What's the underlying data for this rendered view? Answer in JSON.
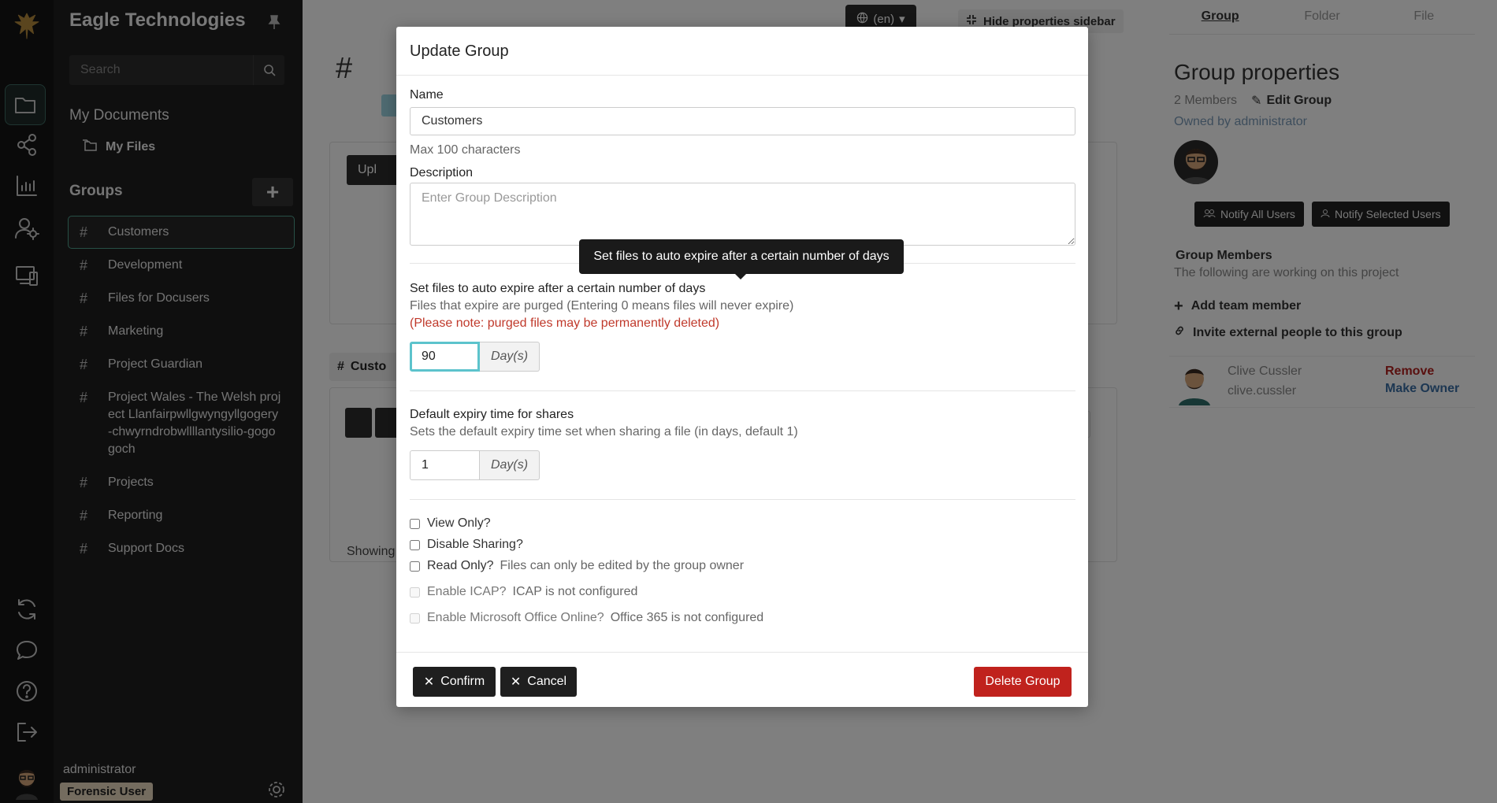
{
  "brand": {
    "name": "Eagle Technologies"
  },
  "sidebar": {
    "search_placeholder": "Search",
    "my_documents": "My Documents",
    "my_files": "My Files",
    "groups_title": "Groups",
    "groups": [
      {
        "label": "Customers"
      },
      {
        "label": "Development"
      },
      {
        "label": "Files for Docusers"
      },
      {
        "label": "Marketing"
      },
      {
        "label": "Project Guardian"
      },
      {
        "label": "Project Wales - The Welsh project Llanfairpwllgwyngyllgogery-chwyrndrobwllllantysilio-gogogoch"
      },
      {
        "label": "Projects"
      },
      {
        "label": "Reporting"
      },
      {
        "label": "Support Docs"
      }
    ],
    "user": {
      "name": "administrator",
      "role": "Forensic User"
    }
  },
  "main": {
    "lang": "(en)",
    "hide_sidebar": "Hide properties sidebar",
    "title_hash": "#",
    "upload_label": "Upl",
    "tab_label": "Custo",
    "showing": "Showing"
  },
  "props": {
    "tabs": [
      "Group",
      "Folder",
      "File"
    ],
    "title": "Group properties",
    "members_count": "2 Members",
    "edit_group": "Edit Group",
    "owned_by": "Owned by administrator",
    "notify_all": "Notify All Users",
    "notify_selected": "Notify Selected Users",
    "members_title": "Group Members",
    "members_subtitle": "The following are working on this project",
    "add_member": "Add team member",
    "invite_external": "Invite external people to this group",
    "member": {
      "name": "Clive Cussler",
      "email": "clive.cussler",
      "remove": "Remove",
      "make_owner": "Make Owner"
    }
  },
  "modal": {
    "title": "Update Group",
    "name_label": "Name",
    "name_value": "Customers",
    "name_hint": "Max 100 characters",
    "desc_label": "Description",
    "desc_placeholder": "Enter Group Description",
    "tooltip": "Set files to auto expire after a certain number of days",
    "expire_label": "Set files to auto expire after a certain number of days",
    "expire_hint": "Files that expire are purged (Entering 0 means files will never expire)",
    "expire_warn": "(Please note: purged files may be permanently deleted)",
    "expire_value": "90",
    "days_addon": "Day(s)",
    "share_label": "Default expiry time for shares",
    "share_hint": "Sets the default expiry time set when sharing a file (in days, default 1)",
    "share_value": "1",
    "view_only": "View Only?",
    "disable_sharing": "Disable Sharing?",
    "read_only": "Read Only?",
    "read_only_sub": "Files can only be edited by the group owner",
    "enable_icap": "Enable ICAP?",
    "icap_sub": "ICAP is not configured",
    "enable_office": "Enable Microsoft Office Online?",
    "office_sub": "Office 365 is not configured",
    "confirm": "Confirm",
    "cancel": "Cancel",
    "delete": "Delete Group"
  }
}
